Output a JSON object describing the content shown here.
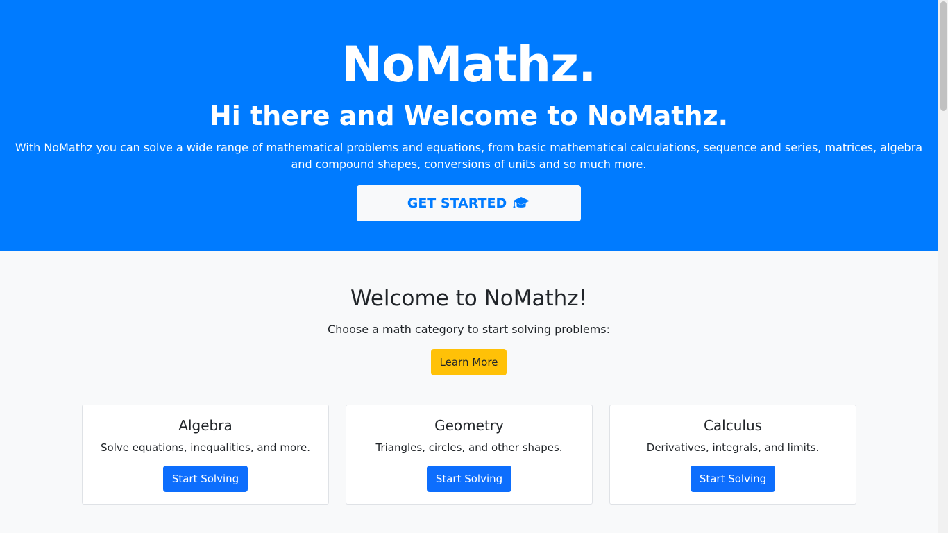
{
  "hero": {
    "title": "NoMathz.",
    "subtitle": "Hi there and Welcome to NoMathz.",
    "description": "With NoMathz you can solve a wide range of mathematical problems and equations, from basic mathematical calculations, sequence and series, matrices, algebra and compound shapes, conversions of units and so much more.",
    "cta_label": "GET STARTED",
    "cta_icon": "graduation-cap-icon"
  },
  "welcome": {
    "title": "Welcome to NoMathz!",
    "text": "Choose a math category to start solving problems:",
    "learn_more_label": "Learn More"
  },
  "cards": [
    {
      "title": "Algebra",
      "text": "Solve equations, inequalities, and more.",
      "button_label": "Start Solving"
    },
    {
      "title": "Geometry",
      "text": "Triangles, circles, and other shapes.",
      "button_label": "Start Solving"
    },
    {
      "title": "Calculus",
      "text": "Derivatives, integrals, and limits.",
      "button_label": "Start Solving"
    }
  ],
  "colors": {
    "hero_background": "#007bff",
    "page_background": "#f8f9fa",
    "learn_more_button": "#ffc107",
    "primary_button": "#0d6efd"
  }
}
